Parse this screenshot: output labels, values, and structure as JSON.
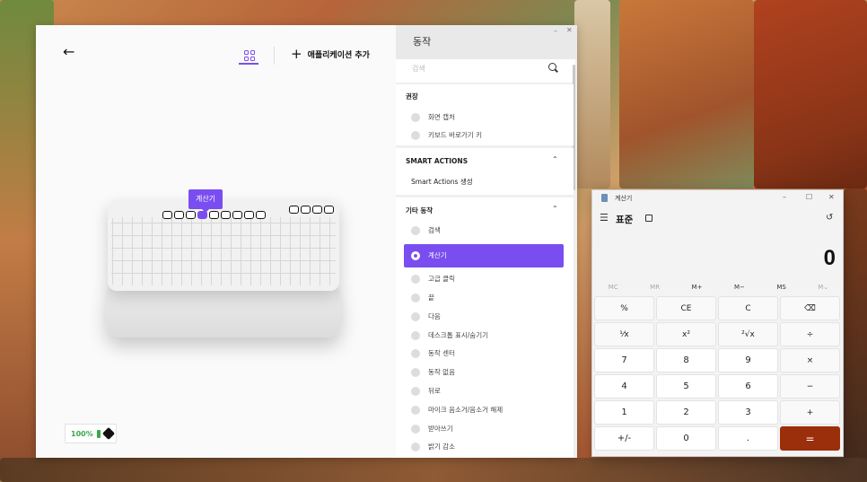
{
  "logi": {
    "back_icon": "←",
    "add_app_label": "애플리케이션 추가",
    "tooltip": "계산기",
    "battery": "100%",
    "panel": {
      "title": "동작",
      "search_placeholder": "검색",
      "recommended": {
        "label": "권장",
        "items": [
          "화면 캡처",
          "키보드 바로가기 키"
        ]
      },
      "smart_actions": {
        "label": "SMART ACTIONS",
        "item": "Smart Actions 생성"
      },
      "other_actions": {
        "label": "기타 동작",
        "items": [
          "검색",
          "계산기",
          "고급 클릭",
          "끝",
          "다음",
          "데스크톱 표시/숨기기",
          "동작 센터",
          "동작 없음",
          "뒤로",
          "마이크 음소거/음소거 해제",
          "받아쓰기",
          "밝기 감소"
        ],
        "selected": "계산기"
      }
    }
  },
  "calculator": {
    "title": "계산기",
    "mode": "표준",
    "display": "0",
    "memory": [
      "MC",
      "MR",
      "M+",
      "M−",
      "MS",
      "M⌄"
    ],
    "keys": [
      "%",
      "CE",
      "C",
      "⌫",
      "⅟x",
      "x²",
      "²√x",
      "÷",
      "7",
      "8",
      "9",
      "×",
      "4",
      "5",
      "6",
      "−",
      "1",
      "2",
      "3",
      "+",
      "+/-",
      "0",
      ".",
      "="
    ],
    "equals_color": "#9c2f0b"
  },
  "accent_color": "#7a4df0"
}
